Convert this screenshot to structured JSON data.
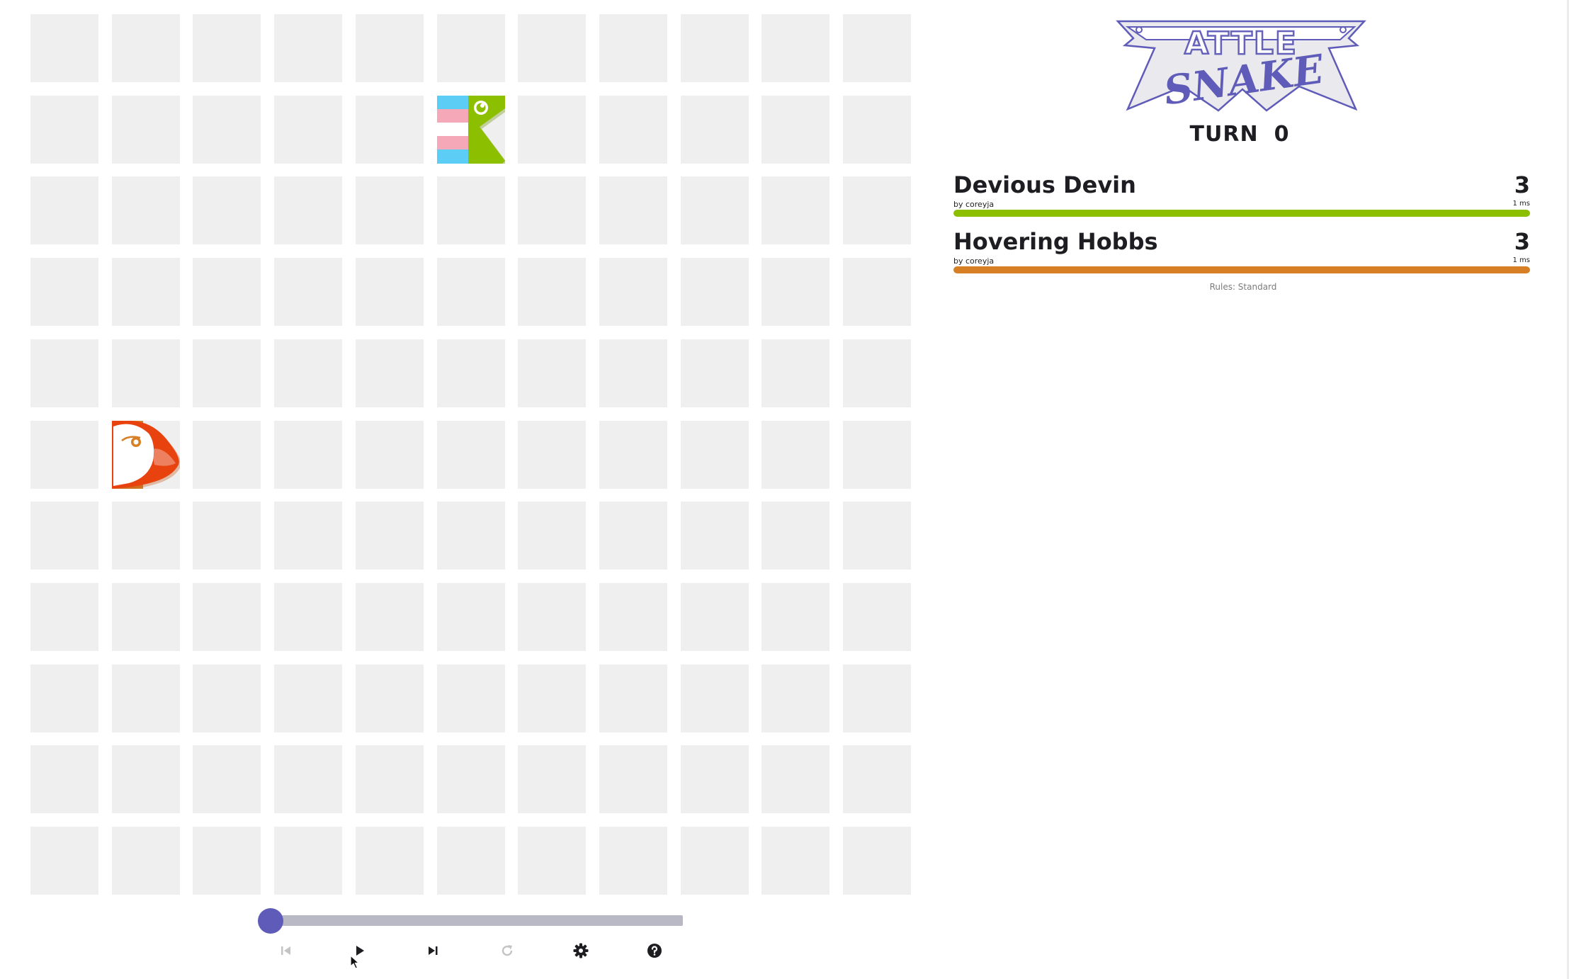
{
  "game": {
    "turn_label": "TURN",
    "turn_value": "0",
    "rules_text": "Rules: Standard",
    "logo_text": "BATTLESNAKE",
    "logo_sub": "SNAKE"
  },
  "board": {
    "columns": 11,
    "rows": 11,
    "cell_color": "#efefef",
    "snakes": [
      {
        "name": "Devious Devin",
        "head_icon": "snake-head-green-icon",
        "head_color": "#8cbf00",
        "tail_pattern": "trans-flag-stripes",
        "tail_colors": [
          "#5ccdf5",
          "#f5a9b8",
          "#ffffff"
        ],
        "head_cell": {
          "col": 5,
          "row": 1
        },
        "facing": "right"
      },
      {
        "name": "Hovering Hobbs",
        "head_icon": "snake-head-puffin-icon",
        "head_color": "#e8430f",
        "body_color": "#d77f24",
        "head_cell": {
          "col": 1,
          "row": 5
        },
        "facing": "right"
      }
    ]
  },
  "scoreboard": [
    {
      "name": "Devious Devin",
      "author": "by coreyja",
      "length": "3",
      "latency": "1 ms",
      "health_color": "#8cbf00",
      "health": 1.0
    },
    {
      "name": "Hovering Hobbs",
      "author": "by coreyja",
      "length": "3",
      "latency": "1 ms",
      "health_color": "#d77f24",
      "health": 1.0
    }
  ],
  "playback": {
    "progress": 0,
    "accent_color": "#5f5bb8",
    "controls": [
      {
        "icon": "skip-to-start-icon",
        "enabled": false
      },
      {
        "icon": "play-icon",
        "enabled": true
      },
      {
        "icon": "step-forward-icon",
        "enabled": true
      },
      {
        "icon": "reload-icon",
        "enabled": false
      },
      {
        "icon": "gear-icon",
        "enabled": true
      },
      {
        "icon": "help-icon",
        "enabled": true
      }
    ]
  }
}
